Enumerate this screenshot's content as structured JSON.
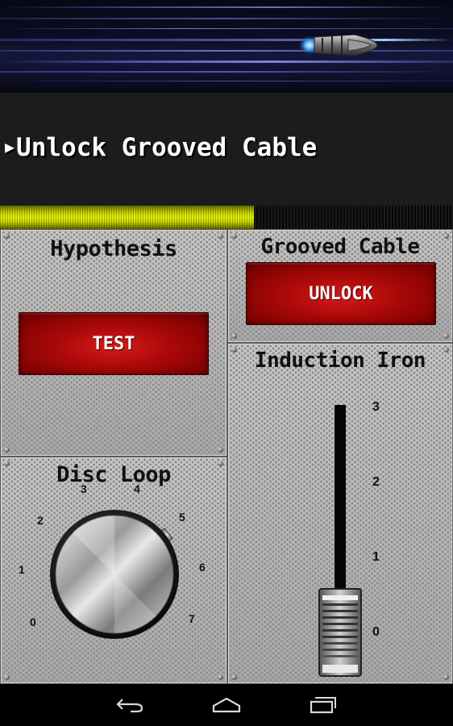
{
  "mission": {
    "arrow": "▶",
    "label": "Unlock Grooved Cable",
    "progress": 0.56
  },
  "panels": {
    "hypothesis": {
      "title": "Hypothesis",
      "button": "TEST"
    },
    "grooved_cable": {
      "title": "Grooved Cable",
      "button": "UNLOCK"
    },
    "disc_loop": {
      "title": "Disc Loop",
      "dial_labels": [
        "0",
        "1",
        "2",
        "3",
        "4",
        "5",
        "6",
        "7"
      ],
      "value": 5
    },
    "induction_iron": {
      "title": "Induction Iron",
      "ticks": [
        "3",
        "2",
        "1",
        "0"
      ],
      "value": 0
    }
  },
  "colors": {
    "progress": "#d4de0a",
    "button_red": "#b00d0d",
    "panel": "#b4b4b4"
  },
  "navbar": {
    "icons": [
      "back-icon",
      "home-icon",
      "recent-apps-icon"
    ]
  }
}
